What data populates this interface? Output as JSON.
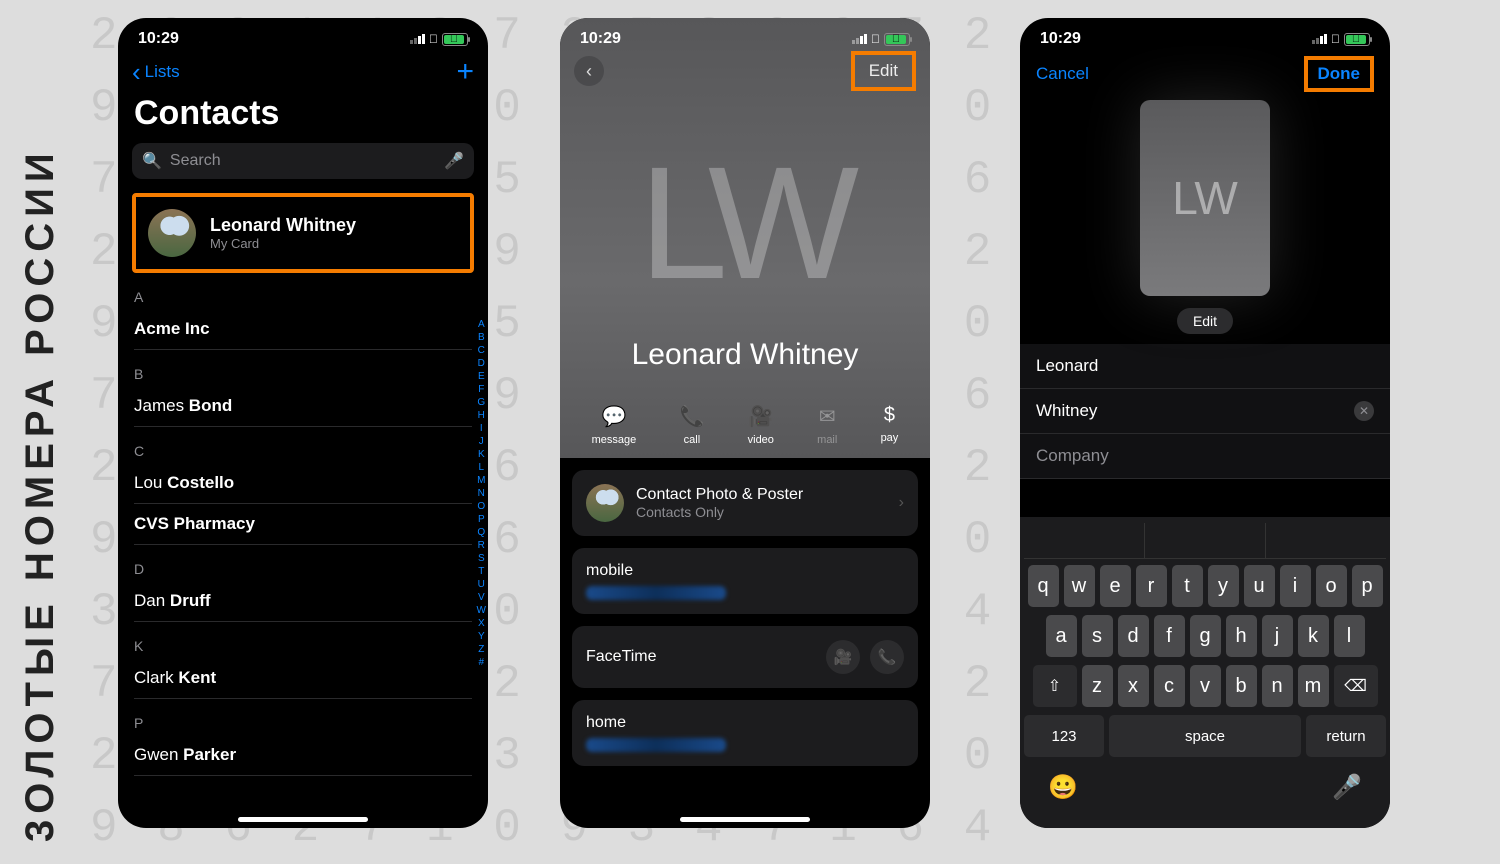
{
  "background_rows": "2 0 9 1 4 8 7 2 5 3 6 0 7 2\n9 5 8 3 1 7 0 4 2 6 9 1 3 0\n7 2 0 6 4 0 5 1 8 3 4 2 6 6\n2 7 0 2 3 0 9 3 6 0 9 1 5 2\n9 6 8 1 7 4 5 0 2 8 9 3 1 0\n7 8 0 5 3 2 9 2 5 6 4 7 8 6\n2 0 9 1 4 7 6 0 3 8 5 0 7 2\n9 5 8 3 1 7 6 3 2 5 9 1 3 0\n3 1 4 6 2 5 0 9 5 1 8 6 0 4\n7 2 5 0 3 7 2 1 3 6 8 5 7 2\n2 0 5 3 1 4 3 0 6 6 4 2 5 0\n9 8 6 2 7 1 0 9 3 4 7 1 6 4",
  "logo_text": "3ОЛОТЫЕ НОМЕРА РОССИИ",
  "status": {
    "time": "10:29"
  },
  "s1": {
    "back": "Lists",
    "title": "Contacts",
    "search_placeholder": "Search",
    "mycard": {
      "name": "Leonard Whitney",
      "sub": "My Card"
    },
    "sections": [
      {
        "h": "A",
        "rows": [
          {
            "pre": "",
            "bold": "Acme Inc"
          }
        ]
      },
      {
        "h": "B",
        "rows": [
          {
            "pre": "James ",
            "bold": "Bond"
          }
        ]
      },
      {
        "h": "C",
        "rows": [
          {
            "pre": "Lou ",
            "bold": "Costello"
          },
          {
            "pre": "",
            "bold": "CVS Pharmacy"
          }
        ]
      },
      {
        "h": "D",
        "rows": [
          {
            "pre": "Dan ",
            "bold": "Druff"
          }
        ]
      },
      {
        "h": "K",
        "rows": [
          {
            "pre": "Clark ",
            "bold": "Kent"
          }
        ]
      },
      {
        "h": "P",
        "rows": [
          {
            "pre": "Gwen ",
            "bold": "Parker"
          }
        ]
      }
    ],
    "index": [
      "A",
      "B",
      "C",
      "D",
      "E",
      "F",
      "G",
      "H",
      "I",
      "J",
      "K",
      "L",
      "M",
      "N",
      "O",
      "P",
      "Q",
      "R",
      "S",
      "T",
      "U",
      "V",
      "W",
      "X",
      "Y",
      "Z",
      "#"
    ]
  },
  "s2": {
    "edit": "Edit",
    "initials": "LW",
    "name": "Leonard Whitney",
    "actions": [
      {
        "icon": "💬",
        "label": "message",
        "dis": false
      },
      {
        "icon": "📞",
        "label": "call",
        "dis": false
      },
      {
        "icon": "🎥",
        "label": "video",
        "dis": false
      },
      {
        "icon": "✉",
        "label": "mail",
        "dis": true
      },
      {
        "icon": "$",
        "label": "pay",
        "dis": false
      }
    ],
    "poster": {
      "title": "Contact Photo & Poster",
      "sub": "Contacts Only"
    },
    "mobile": "mobile",
    "facetime": "FaceTime",
    "home": "home"
  },
  "s3": {
    "cancel": "Cancel",
    "done": "Done",
    "initials": "LW",
    "editpill": "Edit",
    "first": "Leonard",
    "last": "Whitney",
    "company_placeholder": "Company"
  },
  "kb": {
    "r1": [
      "q",
      "w",
      "e",
      "r",
      "t",
      "y",
      "u",
      "i",
      "o",
      "p"
    ],
    "r2": [
      "a",
      "s",
      "d",
      "f",
      "g",
      "h",
      "j",
      "k",
      "l"
    ],
    "r3": [
      "z",
      "x",
      "c",
      "v",
      "b",
      "n",
      "m"
    ],
    "shift": "⇧",
    "del": "⌫",
    "num": "123",
    "space": "space",
    "ret": "return"
  }
}
